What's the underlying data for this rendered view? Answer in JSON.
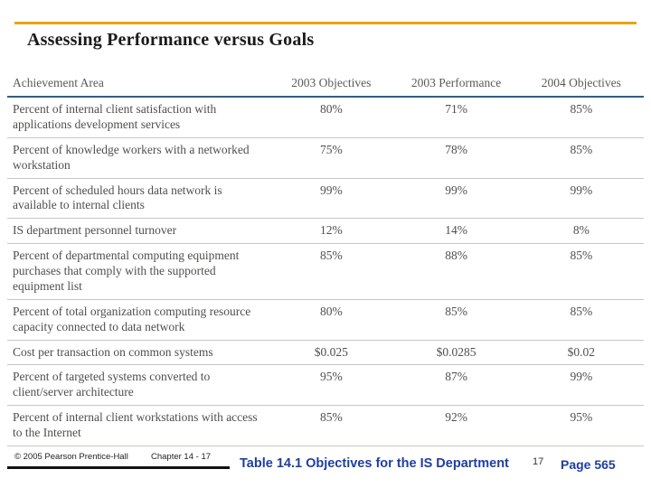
{
  "slide": {
    "title": "Assessing Performance versus Goals"
  },
  "table": {
    "headers": [
      "Achievement Area",
      "2003 Objectives",
      "2003 Performance",
      "2004 Objectives"
    ],
    "rows": [
      {
        "area": "Percent of internal client satisfaction with applications development services",
        "obj2003": "80%",
        "perf2003": "71%",
        "obj2004": "85%"
      },
      {
        "area": "Percent of knowledge workers with a networked workstation",
        "obj2003": "75%",
        "perf2003": "78%",
        "obj2004": "85%"
      },
      {
        "area": "Percent of scheduled hours data network is available to internal clients",
        "obj2003": "99%",
        "perf2003": "99%",
        "obj2004": "99%"
      },
      {
        "area": "IS department personnel turnover",
        "obj2003": "12%",
        "perf2003": "14%",
        "obj2004": "8%"
      },
      {
        "area": "Percent of departmental computing equipment purchases that comply with the supported equipment list",
        "obj2003": "85%",
        "perf2003": "88%",
        "obj2004": "85%"
      },
      {
        "area": "Percent of total organization computing resource capacity connected to data network",
        "obj2003": "80%",
        "perf2003": "85%",
        "obj2004": "85%"
      },
      {
        "area": "Cost per transaction on common systems",
        "obj2003": "$0.025",
        "perf2003": "$0.0285",
        "obj2004": "$0.02"
      },
      {
        "area": "Percent of targeted systems converted to client/server architecture",
        "obj2003": "95%",
        "perf2003": "87%",
        "obj2004": "99%"
      },
      {
        "area": "Percent of internal client workstations with access to the Internet",
        "obj2003": "85%",
        "perf2003": "92%",
        "obj2004": "95%"
      }
    ]
  },
  "footer": {
    "copyright": "© 2005 Pearson Prentice-Hall",
    "chapter": "Chapter 14 - 17",
    "caption": "Table 14.1  Objectives for the IS Department",
    "slide_number": "17",
    "page_label": "Page 565"
  },
  "colors": {
    "accent_rule": "#E8A400",
    "header_underline": "#2e5f8a",
    "caption_blue": "#1F3FA0",
    "footer_rule": "#111111"
  }
}
